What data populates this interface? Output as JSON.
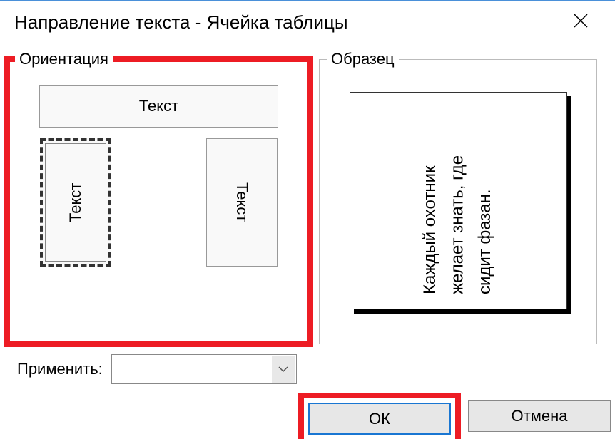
{
  "title": "Направление текста - Ячейка таблицы",
  "orientation": {
    "label_initial": "О",
    "label_rest": "риентация",
    "horizontal": "Текст",
    "vertical_up": "Текст",
    "vertical_down": "Текст"
  },
  "sample": {
    "label": "Образец",
    "text": "Каждый охотник желает знать, где сидит фазан."
  },
  "apply": {
    "label": "Применить:"
  },
  "buttons": {
    "ok": "ОК",
    "cancel": "Отмена"
  }
}
